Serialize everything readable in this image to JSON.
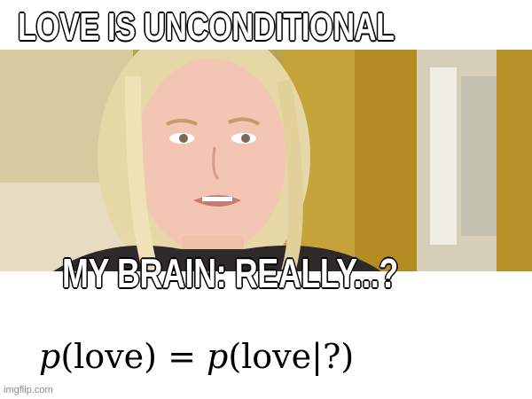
{
  "meme": {
    "top_caption": "LOVE IS UNCONDITIONAL",
    "bottom_caption": "MY BRAIN: REALLY...?",
    "formula": {
      "p_left": "p",
      "left_paren_open": "(",
      "left_arg": "love",
      "left_paren_close": ")",
      "equals": " = ",
      "p_right": "p",
      "right_open": "(",
      "right_arg": "love",
      "bar": "|",
      "condition": "?",
      "right_close": ")"
    },
    "watermark": "imgflip.com"
  },
  "colors": {
    "caption_fill": "#ffffff",
    "caption_stroke": "#000000",
    "background": "#ffffff",
    "text": "#000000"
  }
}
